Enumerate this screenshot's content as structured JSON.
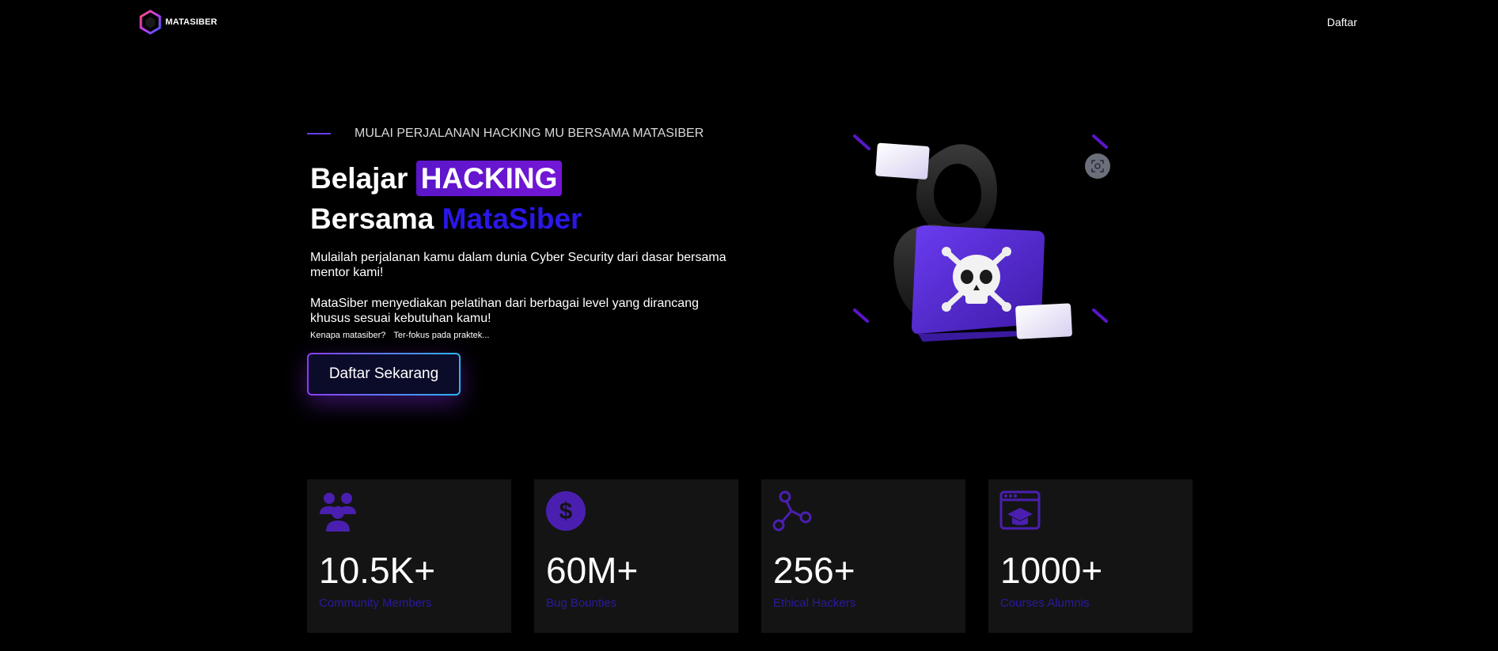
{
  "nav": {
    "brand": "MATASIBER",
    "register_link": "Daftar"
  },
  "hero": {
    "eyebrow": "MULAI PERJALANAN HACKING MU BERSAMA MATASIBER",
    "headline_line1_prefix": "Belajar",
    "headline_highlight": "HACKING",
    "headline_line2_prefix": "Bersama",
    "headline_brand": "MataSiber",
    "paragraph1": "Mulailah perjalanan kamu dalam dunia Cyber Security dari dasar bersama mentor kami!",
    "paragraph2": "MataSiber menyediakan pelatihan dari berbagai level yang dirancang khusus sesuai kebutuhan kamu!",
    "why_question": "Kenapa matasiber?",
    "why_answer": "Ter-fokus pada praktek...",
    "cta_label": "Daftar Sekarang"
  },
  "illustration": {
    "icon": "hacker-laptop-skull-illustration",
    "scan_icon": "scan-icon"
  },
  "stats": [
    {
      "icon": "community-icon",
      "value": "10.5K+",
      "label": "Community Members"
    },
    {
      "icon": "dollar-icon",
      "value": "60M+",
      "label": "Bug Bounties"
    },
    {
      "icon": "network-icon",
      "value": "256+",
      "label": "Ethical Hackers"
    },
    {
      "icon": "course-icon",
      "value": "1000+",
      "label": "Courses Alumnis"
    }
  ],
  "colors": {
    "accent": "#5a16c9",
    "brand_blue": "#2a17e8",
    "label": "#2a1a9e",
    "card_bg": "#141414"
  }
}
